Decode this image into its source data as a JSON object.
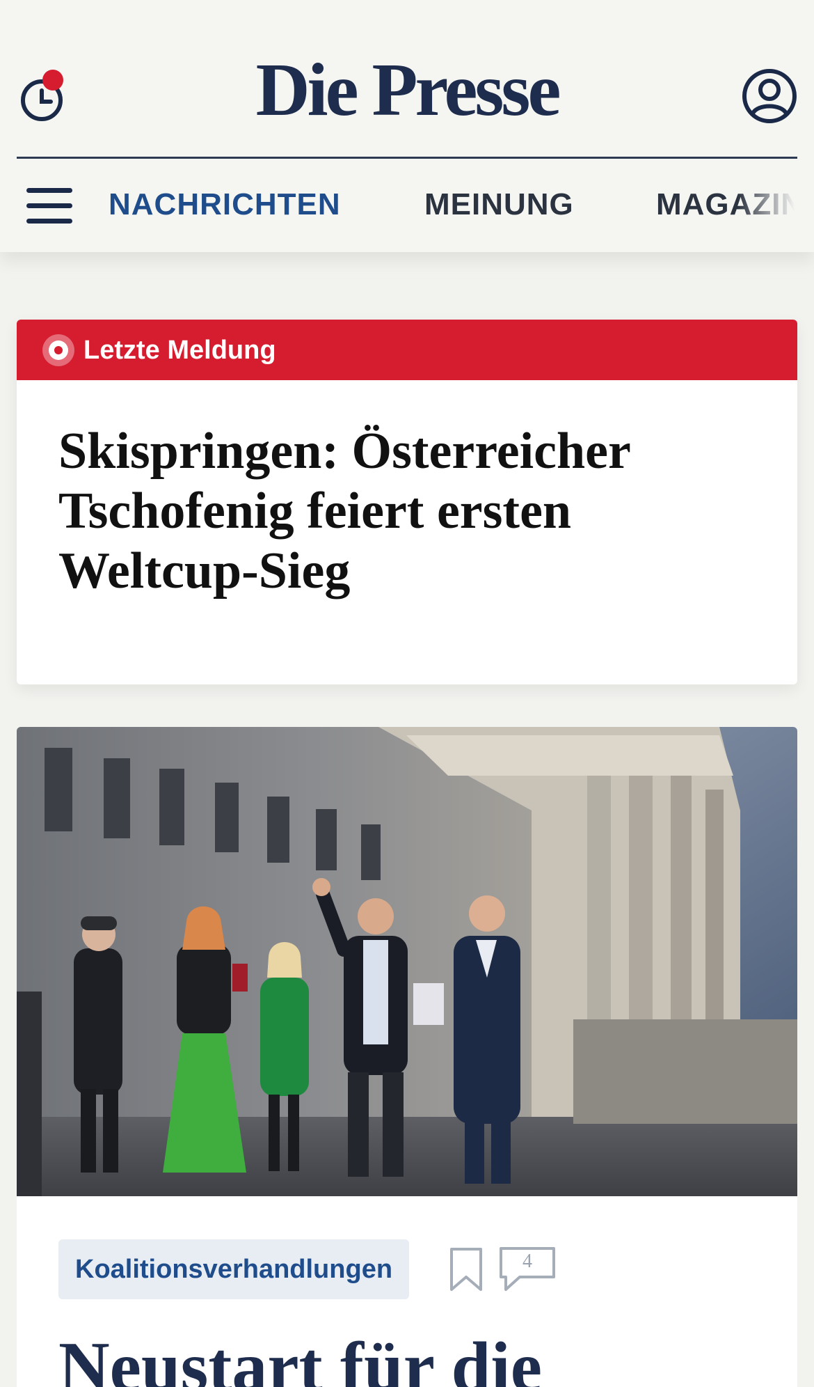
{
  "header": {
    "logo_text": "Die Presse",
    "history_icon": "clock-history-icon",
    "account_icon": "user-account-icon",
    "notification_color": "#d61c2f"
  },
  "nav": {
    "menu_icon": "hamburger-menu-icon",
    "items": [
      {
        "label": "NACHRICHTEN",
        "active": true
      },
      {
        "label": "MEINUNG",
        "active": false
      },
      {
        "label": "MAGAZIN",
        "active": false
      }
    ]
  },
  "breaking": {
    "label": "Letzte Meldung",
    "headline": "Skispringen: Österreicher Tschofenig feiert ersten Weltcup-Sieg",
    "bar_color": "#d61c2f"
  },
  "article": {
    "topic": "Koalitionsverhandlungen",
    "bookmark_icon": "bookmark-icon",
    "comment_icon": "comment-icon",
    "comment_count": "4",
    "headline": "Neustart für die"
  },
  "colors": {
    "brand_navy": "#1e2d4d",
    "link_blue": "#1f4d8c",
    "breaking_red": "#d61c2f",
    "page_bg": "#f2f2ef"
  }
}
